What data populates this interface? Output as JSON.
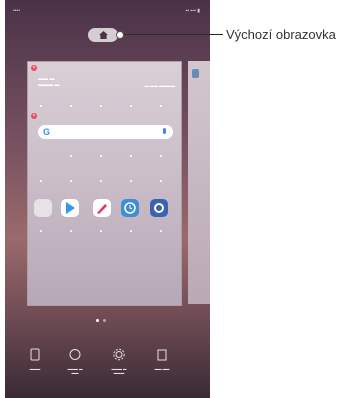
{
  "callout": {
    "label": "Výchozí obrazovka"
  },
  "colors": {
    "remove": "#e84a5f",
    "google_blue": "#4285f4"
  },
  "icons": {
    "home": "home-icon",
    "search_logo": "google-g-icon",
    "mic": "microphone-icon",
    "bottom": [
      "widgets-icon",
      "wallpaper-icon",
      "settings-gear-icon",
      "apps-icon"
    ]
  },
  "apps": [
    "folder-icon",
    "play-store-icon",
    "pencil-icon",
    "clock-icon",
    "settings-icon"
  ]
}
